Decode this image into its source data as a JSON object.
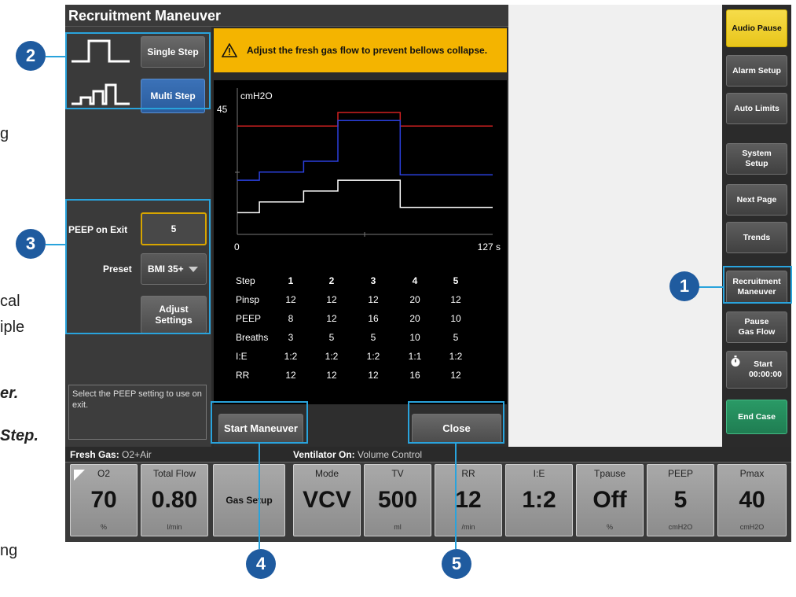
{
  "background_text": {
    "frag1": "g",
    "frag2": "cal",
    "frag3": "iple",
    "frag4": "er.",
    "frag5": "Step.",
    "frag6": "ng"
  },
  "dialog": {
    "title": "Recruitment Maneuver",
    "single_step_label": "Single Step",
    "multi_step_label": "Multi Step",
    "peep_on_exit_label": "PEEP on Exit",
    "peep_on_exit_value": "5",
    "preset_label": "Preset",
    "preset_value": "BMI 35+",
    "adjust_settings_label": "Adjust Settings",
    "hint_text": "Select the PEEP setting to use on exit.",
    "alert_text": "Adjust the fresh gas flow to prevent bellows collapse.",
    "start_button": "Start Maneuver",
    "close_button": "Close"
  },
  "chart_data": {
    "type": "line",
    "ylabel": "cmH2O",
    "y_tick_top": "45",
    "x_start_label": "0",
    "x_end_label": "127 s",
    "xlim": [
      0,
      127
    ],
    "ylim": [
      0,
      45
    ],
    "series": [
      {
        "color": "#d02020",
        "points": [
          [
            0,
            40
          ],
          [
            50,
            40
          ],
          [
            50,
            45
          ],
          [
            81,
            45
          ],
          [
            81,
            40
          ],
          [
            127,
            40
          ]
        ]
      },
      {
        "color": "#2a3fdc",
        "points": [
          [
            0,
            20
          ],
          [
            11,
            20
          ],
          [
            11,
            23
          ],
          [
            33,
            23
          ],
          [
            33,
            27
          ],
          [
            50,
            27
          ],
          [
            50,
            42
          ],
          [
            81,
            42
          ],
          [
            81,
            22
          ],
          [
            127,
            22
          ]
        ]
      },
      {
        "color": "#ffffff",
        "points": [
          [
            0,
            8
          ],
          [
            11,
            8
          ],
          [
            11,
            12
          ],
          [
            33,
            12
          ],
          [
            33,
            16
          ],
          [
            50,
            16
          ],
          [
            50,
            20
          ],
          [
            81,
            20
          ],
          [
            81,
            10
          ],
          [
            127,
            10
          ]
        ]
      }
    ]
  },
  "step_table": {
    "headers": [
      "Step",
      "1",
      "2",
      "3",
      "4",
      "5"
    ],
    "rows": [
      {
        "label": "Pinsp",
        "values": [
          "12",
          "12",
          "12",
          "20",
          "12"
        ]
      },
      {
        "label": "PEEP",
        "values": [
          "8",
          "12",
          "16",
          "20",
          "10"
        ]
      },
      {
        "label": "Breaths",
        "values": [
          "3",
          "5",
          "5",
          "10",
          "5"
        ]
      },
      {
        "label": "I:E",
        "values": [
          "1:2",
          "1:2",
          "1:2",
          "1:1",
          "1:2"
        ]
      },
      {
        "label": "RR",
        "values": [
          "12",
          "12",
          "12",
          "16",
          "12"
        ]
      }
    ]
  },
  "sidebar": {
    "audio_pause": "Audio Pause",
    "alarm_setup": "Alarm Setup",
    "auto_limits": "Auto Limits",
    "system_setup": "System Setup",
    "next_page": "Next Page",
    "trends": "Trends",
    "recruitment_maneuver": "Recruitment Maneuver",
    "pause_gas_flow": "Pause Gas Flow",
    "start_label": "Start",
    "start_time": "00:00:00",
    "end_case": "End Case"
  },
  "bottom": {
    "fresh_gas_header": "Fresh Gas:",
    "fresh_gas_value": "O2+Air",
    "ventilator_header": "Ventilator On:",
    "ventilator_value": "Volume Control",
    "tiles": [
      {
        "label": "O2",
        "value": "70",
        "unit": "%"
      },
      {
        "label": "Total Flow",
        "value": "0.80",
        "unit": "l/min"
      },
      {
        "label": "Mode",
        "value": "VCV",
        "unit": ""
      },
      {
        "label": "TV",
        "value": "500",
        "unit": "ml"
      },
      {
        "label": "RR",
        "value": "12",
        "unit": "/min"
      },
      {
        "label": "I:E",
        "value": "1:2",
        "unit": ""
      },
      {
        "label": "Tpause",
        "value": "Off",
        "unit": "%"
      },
      {
        "label": "PEEP",
        "value": "5",
        "unit": "cmH2O"
      },
      {
        "label": "Pmax",
        "value": "40",
        "unit": "cmH2O"
      }
    ],
    "gas_setup": "Gas Setup"
  },
  "callouts": [
    "1",
    "2",
    "3",
    "4",
    "5"
  ],
  "colors": {
    "callout": "#29a3dc",
    "callout_fill": "#1f5b9f",
    "alert": "#f4b400",
    "audio_pause": "#f6dc4a",
    "end_case": "#2a9a66",
    "multi_step_active": "#3b72b8"
  }
}
